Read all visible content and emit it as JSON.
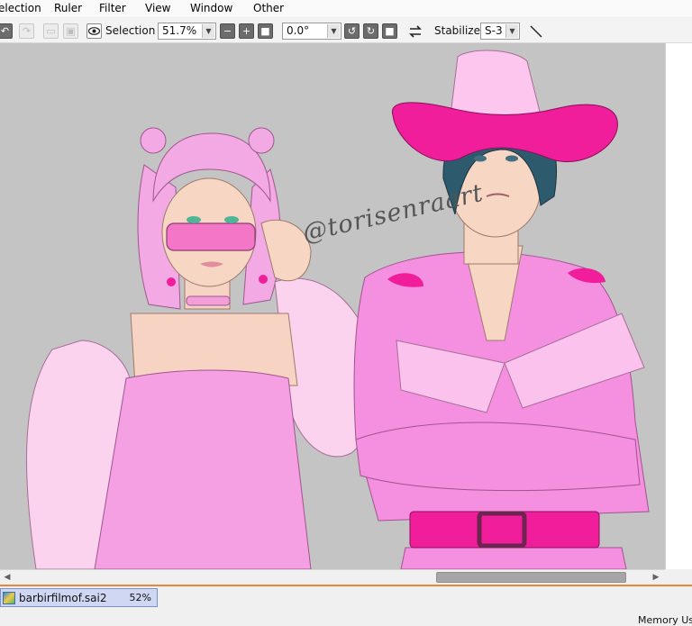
{
  "menubar": {
    "items": [
      "election",
      "Ruler",
      "Filter",
      "View",
      "Window",
      "Other"
    ]
  },
  "toolbar": {
    "selection_label": "Selection",
    "zoom_value": "51.7%",
    "rotation_value": "0.0°",
    "stabilizer_label": "Stabilizer",
    "stabilizer_value": "S-3",
    "icons": [
      "undo-icon",
      "redo-icon",
      "deselect-icon",
      "invert-selection-icon",
      "eye-icon",
      "zoom-out-icon",
      "zoom-in-icon",
      "zoom-reset-icon",
      "rotate-ccw-icon",
      "rotate-cw-icon",
      "rotate-reset-icon",
      "flip-icon",
      "line-tool-icon"
    ]
  },
  "canvas": {
    "background_color": "#c4c4c4",
    "artwork": {
      "watermark": "@torisenraart"
    }
  },
  "document_tab": {
    "filename": "barbirfilmof.sai2",
    "zoom": "52%"
  },
  "status": {
    "memory_label": "Memory Us"
  },
  "colors": {
    "hot_pink": "#f01e9a",
    "light_pink": "#f2a6e0",
    "pale_pink": "#fbd3f0",
    "skin": "#f7d6c4",
    "hair_dark": "#2d5a6d",
    "accent_orange": "#e8863a"
  }
}
